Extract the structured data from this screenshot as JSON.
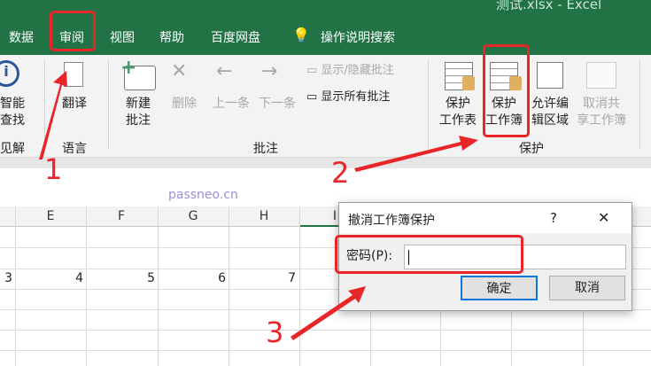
{
  "window": {
    "title": "测试.xlsx  -  Excel"
  },
  "tabs": [
    "数据",
    "审阅",
    "视图",
    "帮助",
    "百度网盘",
    "操作说明搜索"
  ],
  "ribbon": {
    "insights": {
      "btn": [
        "智能",
        "查找"
      ],
      "label": "见解"
    },
    "language": {
      "btn": "翻译",
      "label": "语言"
    },
    "comments": {
      "new": [
        "新建",
        "批注"
      ],
      "delete": "删除",
      "prev": "上一条",
      "next": "下一条",
      "toggle": "显示/隐藏批注",
      "show_all": "显示所有批注",
      "label": "批注"
    },
    "protect": {
      "sheet": [
        "保护",
        "工作表"
      ],
      "workbook": [
        "保护",
        "工作簿"
      ],
      "allow": [
        "允许编",
        "辑区域"
      ],
      "unshare": [
        "取消共",
        "享工作簿"
      ],
      "label": "保护"
    }
  },
  "watermark": "passneo.cn",
  "columns": [
    "E",
    "F",
    "G",
    "H",
    "I"
  ],
  "row_values": [
    "3",
    "4",
    "5",
    "6",
    "7"
  ],
  "dialog": {
    "title": "撤消工作簿保护",
    "help": "?",
    "close": "✕",
    "password_label": "密码(P):",
    "password_value": "",
    "ok": "确定",
    "cancel": "取消"
  },
  "annotations": [
    "1",
    "2",
    "3"
  ],
  "colors": {
    "excel_green": "#217346",
    "annotation_red": "#e8262a"
  }
}
